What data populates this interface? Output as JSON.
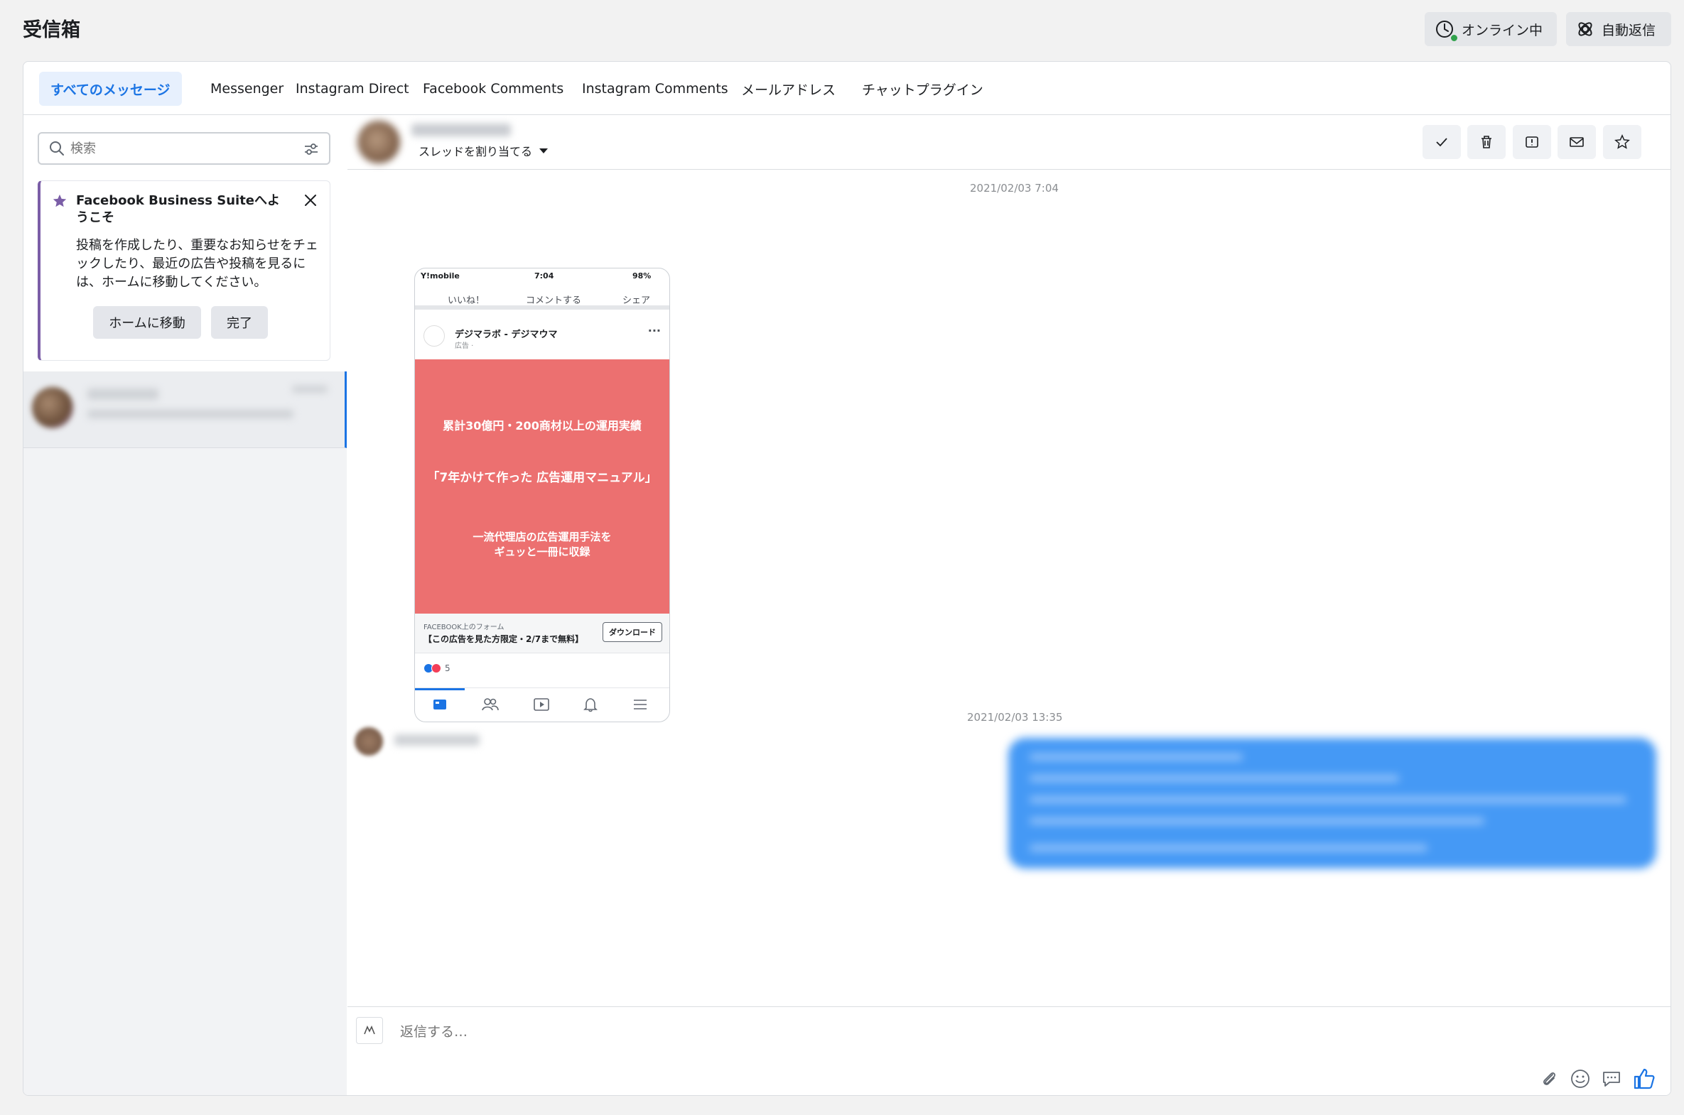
{
  "header": {
    "title": "受信箱",
    "online_label": "オンライン中",
    "auto_reply_label": "自動返信"
  },
  "tabs": [
    {
      "label": "すべてのメッセージ",
      "active": true
    },
    {
      "label": "Messenger"
    },
    {
      "label": "Instagram Direct"
    },
    {
      "label": "Facebook Comments"
    },
    {
      "label": "Instagram Comments"
    },
    {
      "label": "メールアドレス"
    },
    {
      "label": "チャットプラグイン"
    }
  ],
  "sidebar": {
    "search_placeholder": "検索",
    "welcome": {
      "title": "Facebook Business Suiteへようこそ",
      "body": "投稿を作成したり、重要なお知らせをチェックしたり、最近の広告や投稿を見るには、ホームに移動してください。",
      "home_button": "ホームに移動",
      "done_button": "完了"
    }
  },
  "thread": {
    "assign_label": "スレッドを割り当てる",
    "messages": [
      {
        "timestamp": "2021/02/03 7:04"
      },
      {
        "timestamp": "2021/02/03 13:35"
      }
    ],
    "attachment": {
      "carrier": "Y!mobile",
      "time": "7:04",
      "battery": "98%",
      "like": "いいね！",
      "comment": "コメントする",
      "share": "シェア",
      "page_name": "デジマラボ - デジマウマ",
      "sponsored": "広告 · ",
      "ad_line1": "累計30億円・200商材以上の運用実績",
      "ad_line2": "「7年かけて作った 広告運用マニュアル」",
      "ad_line3a": "一流代理店の広告運用手法を",
      "ad_line3b": "ギュッと一冊に収録",
      "form_label": "FACEBOOK上のフォーム",
      "form_title": "【この広告を見た方限定・2/7まで無料】",
      "download": "ダウンロード",
      "reaction_count": "5"
    },
    "composer_placeholder": "返信する…"
  },
  "colors": {
    "accent": "#1b74e4",
    "online": "#31a24c",
    "ad_bg": "#ec7070",
    "bubble": "#4599f5",
    "welcome_border": "#7b5ea7"
  }
}
